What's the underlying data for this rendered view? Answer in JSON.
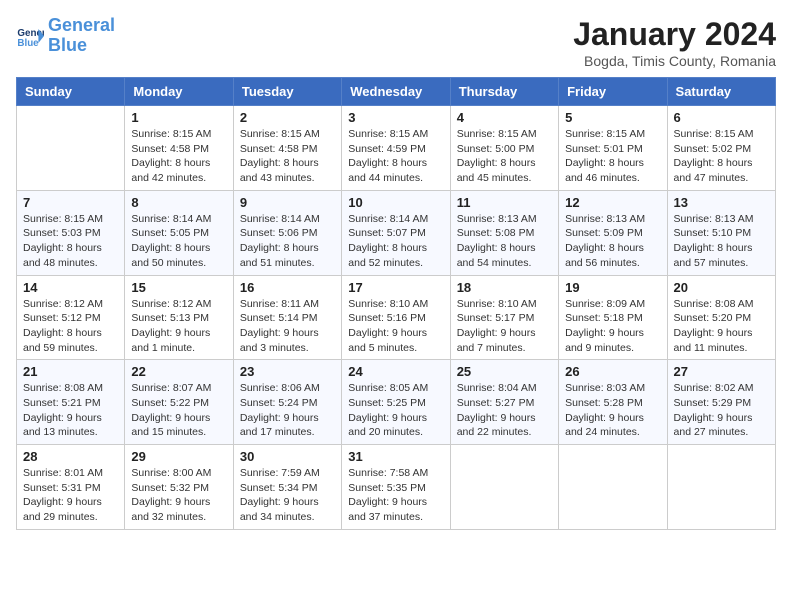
{
  "logo": {
    "text_general": "General",
    "text_blue": "Blue"
  },
  "header": {
    "month": "January 2024",
    "location": "Bogda, Timis County, Romania"
  },
  "weekdays": [
    "Sunday",
    "Monday",
    "Tuesday",
    "Wednesday",
    "Thursday",
    "Friday",
    "Saturday"
  ],
  "weeks": [
    {
      "days": [
        {
          "num": "",
          "empty": true
        },
        {
          "num": "1",
          "sunrise": "8:15 AM",
          "sunset": "4:58 PM",
          "daylight": "8 hours and 42 minutes."
        },
        {
          "num": "2",
          "sunrise": "8:15 AM",
          "sunset": "4:58 PM",
          "daylight": "8 hours and 43 minutes."
        },
        {
          "num": "3",
          "sunrise": "8:15 AM",
          "sunset": "4:59 PM",
          "daylight": "8 hours and 44 minutes."
        },
        {
          "num": "4",
          "sunrise": "8:15 AM",
          "sunset": "5:00 PM",
          "daylight": "8 hours and 45 minutes."
        },
        {
          "num": "5",
          "sunrise": "8:15 AM",
          "sunset": "5:01 PM",
          "daylight": "8 hours and 46 minutes."
        },
        {
          "num": "6",
          "sunrise": "8:15 AM",
          "sunset": "5:02 PM",
          "daylight": "8 hours and 47 minutes."
        }
      ]
    },
    {
      "days": [
        {
          "num": "7",
          "sunrise": "8:15 AM",
          "sunset": "5:03 PM",
          "daylight": "8 hours and 48 minutes."
        },
        {
          "num": "8",
          "sunrise": "8:14 AM",
          "sunset": "5:05 PM",
          "daylight": "8 hours and 50 minutes."
        },
        {
          "num": "9",
          "sunrise": "8:14 AM",
          "sunset": "5:06 PM",
          "daylight": "8 hours and 51 minutes."
        },
        {
          "num": "10",
          "sunrise": "8:14 AM",
          "sunset": "5:07 PM",
          "daylight": "8 hours and 52 minutes."
        },
        {
          "num": "11",
          "sunrise": "8:13 AM",
          "sunset": "5:08 PM",
          "daylight": "8 hours and 54 minutes."
        },
        {
          "num": "12",
          "sunrise": "8:13 AM",
          "sunset": "5:09 PM",
          "daylight": "8 hours and 56 minutes."
        },
        {
          "num": "13",
          "sunrise": "8:13 AM",
          "sunset": "5:10 PM",
          "daylight": "8 hours and 57 minutes."
        }
      ]
    },
    {
      "days": [
        {
          "num": "14",
          "sunrise": "8:12 AM",
          "sunset": "5:12 PM",
          "daylight": "8 hours and 59 minutes."
        },
        {
          "num": "15",
          "sunrise": "8:12 AM",
          "sunset": "5:13 PM",
          "daylight": "9 hours and 1 minute."
        },
        {
          "num": "16",
          "sunrise": "8:11 AM",
          "sunset": "5:14 PM",
          "daylight": "9 hours and 3 minutes."
        },
        {
          "num": "17",
          "sunrise": "8:10 AM",
          "sunset": "5:16 PM",
          "daylight": "9 hours and 5 minutes."
        },
        {
          "num": "18",
          "sunrise": "8:10 AM",
          "sunset": "5:17 PM",
          "daylight": "9 hours and 7 minutes."
        },
        {
          "num": "19",
          "sunrise": "8:09 AM",
          "sunset": "5:18 PM",
          "daylight": "9 hours and 9 minutes."
        },
        {
          "num": "20",
          "sunrise": "8:08 AM",
          "sunset": "5:20 PM",
          "daylight": "9 hours and 11 minutes."
        }
      ]
    },
    {
      "days": [
        {
          "num": "21",
          "sunrise": "8:08 AM",
          "sunset": "5:21 PM",
          "daylight": "9 hours and 13 minutes."
        },
        {
          "num": "22",
          "sunrise": "8:07 AM",
          "sunset": "5:22 PM",
          "daylight": "9 hours and 15 minutes."
        },
        {
          "num": "23",
          "sunrise": "8:06 AM",
          "sunset": "5:24 PM",
          "daylight": "9 hours and 17 minutes."
        },
        {
          "num": "24",
          "sunrise": "8:05 AM",
          "sunset": "5:25 PM",
          "daylight": "9 hours and 20 minutes."
        },
        {
          "num": "25",
          "sunrise": "8:04 AM",
          "sunset": "5:27 PM",
          "daylight": "9 hours and 22 minutes."
        },
        {
          "num": "26",
          "sunrise": "8:03 AM",
          "sunset": "5:28 PM",
          "daylight": "9 hours and 24 minutes."
        },
        {
          "num": "27",
          "sunrise": "8:02 AM",
          "sunset": "5:29 PM",
          "daylight": "9 hours and 27 minutes."
        }
      ]
    },
    {
      "days": [
        {
          "num": "28",
          "sunrise": "8:01 AM",
          "sunset": "5:31 PM",
          "daylight": "9 hours and 29 minutes."
        },
        {
          "num": "29",
          "sunrise": "8:00 AM",
          "sunset": "5:32 PM",
          "daylight": "9 hours and 32 minutes."
        },
        {
          "num": "30",
          "sunrise": "7:59 AM",
          "sunset": "5:34 PM",
          "daylight": "9 hours and 34 minutes."
        },
        {
          "num": "31",
          "sunrise": "7:58 AM",
          "sunset": "5:35 PM",
          "daylight": "9 hours and 37 minutes."
        },
        {
          "num": "",
          "empty": true
        },
        {
          "num": "",
          "empty": true
        },
        {
          "num": "",
          "empty": true
        }
      ]
    }
  ]
}
